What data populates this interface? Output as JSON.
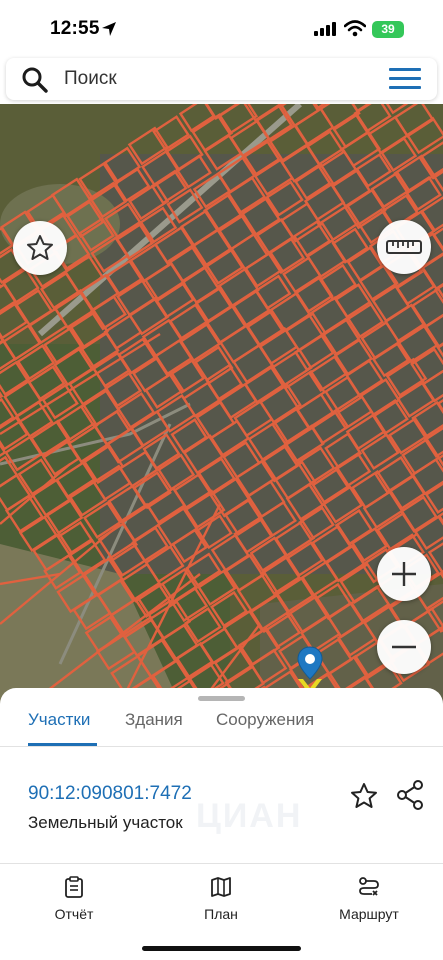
{
  "status_bar": {
    "time": "12:55",
    "battery": "39"
  },
  "search": {
    "placeholder": "Поиск"
  },
  "map_controls": {
    "favorite": "star-icon",
    "ruler": "ruler-icon",
    "zoom_in": "plus-icon",
    "zoom_out": "minus-icon",
    "layers": "layers-icon",
    "my_location": "navigation-arrow-icon"
  },
  "tabs": [
    {
      "label": "Участки",
      "active": true
    },
    {
      "label": "Здания",
      "active": false
    },
    {
      "label": "Сооружения",
      "active": false
    }
  ],
  "selected_parcel": {
    "number": "90:12:090801:7472",
    "type": "Земельный участок"
  },
  "watermark": "ЦИАН",
  "bottom_nav": [
    {
      "label": "Отчёт",
      "icon": "clipboard-icon"
    },
    {
      "label": "План",
      "icon": "map-icon"
    },
    {
      "label": "Маршрут",
      "icon": "route-icon"
    }
  ],
  "colors": {
    "accent": "#1e6fb5",
    "parcel_border": "#e0613f",
    "battery": "#34c759",
    "pin": "#1e78c2",
    "pin_base": "#e8d923"
  }
}
